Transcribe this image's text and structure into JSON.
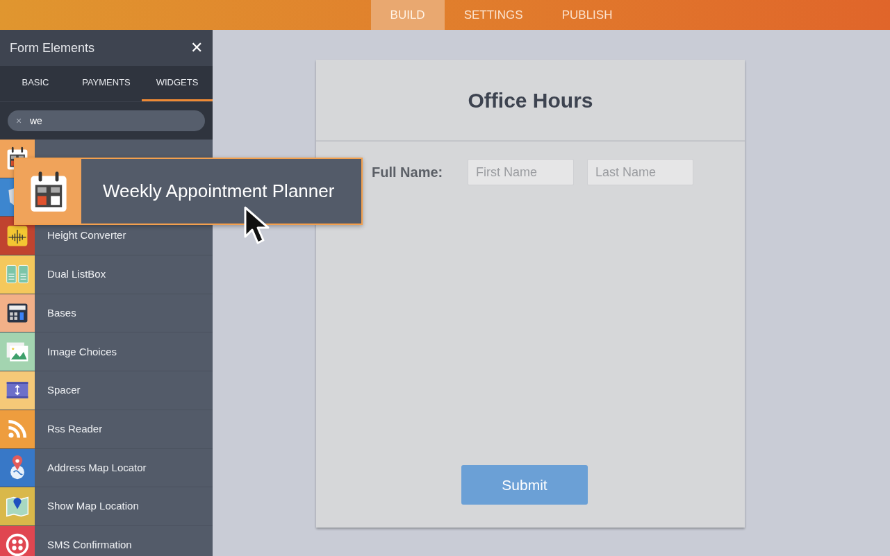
{
  "top_tabs": [
    {
      "label": "BUILD",
      "selected": true
    },
    {
      "label": "SETTINGS",
      "selected": false
    },
    {
      "label": "PUBLISH",
      "selected": false
    }
  ],
  "panel": {
    "title": "Form Elements",
    "close": "✕",
    "tabs": [
      {
        "label": "BASIC",
        "selected": false
      },
      {
        "label": "PAYMENTS",
        "selected": false
      },
      {
        "label": "WIDGETS",
        "selected": true
      }
    ],
    "search": {
      "value": "we",
      "clear": "×"
    },
    "items": [
      {
        "kind": "calendar",
        "color": "#f0a35a"
      },
      {
        "kind": "shield",
        "color": "#3d86cf"
      },
      {
        "kind": "meter",
        "color": "#c0432f",
        "label": "Height Converter"
      },
      {
        "kind": "listbox",
        "color": "#f4c85c",
        "label": "Dual ListBox"
      },
      {
        "kind": "calculator",
        "color": "#f2b088",
        "label": "Bases"
      },
      {
        "kind": "image",
        "color": "#a3d4b0",
        "label": "Image Choices"
      },
      {
        "kind": "spacer",
        "color": "#f5c978",
        "label": "Spacer"
      },
      {
        "kind": "rss",
        "color": "#ee9d3e",
        "label": "Rss Reader"
      },
      {
        "kind": "pin",
        "color": "#3878c7",
        "label": "Address Map Locator"
      },
      {
        "kind": "map",
        "color": "#d9b84a",
        "label": "Show Map Location"
      },
      {
        "kind": "sms",
        "color": "#e04650",
        "label": "SMS Confirmation"
      }
    ]
  },
  "drag_ghost": {
    "kind": "calendar",
    "label": "Weekly Appointment Planner"
  },
  "form": {
    "title": "Office Hours",
    "field_label": "Full Name:",
    "inputs": [
      {
        "placeholder": "First Name"
      },
      {
        "placeholder": "Last Name"
      }
    ],
    "submit": "Submit"
  }
}
